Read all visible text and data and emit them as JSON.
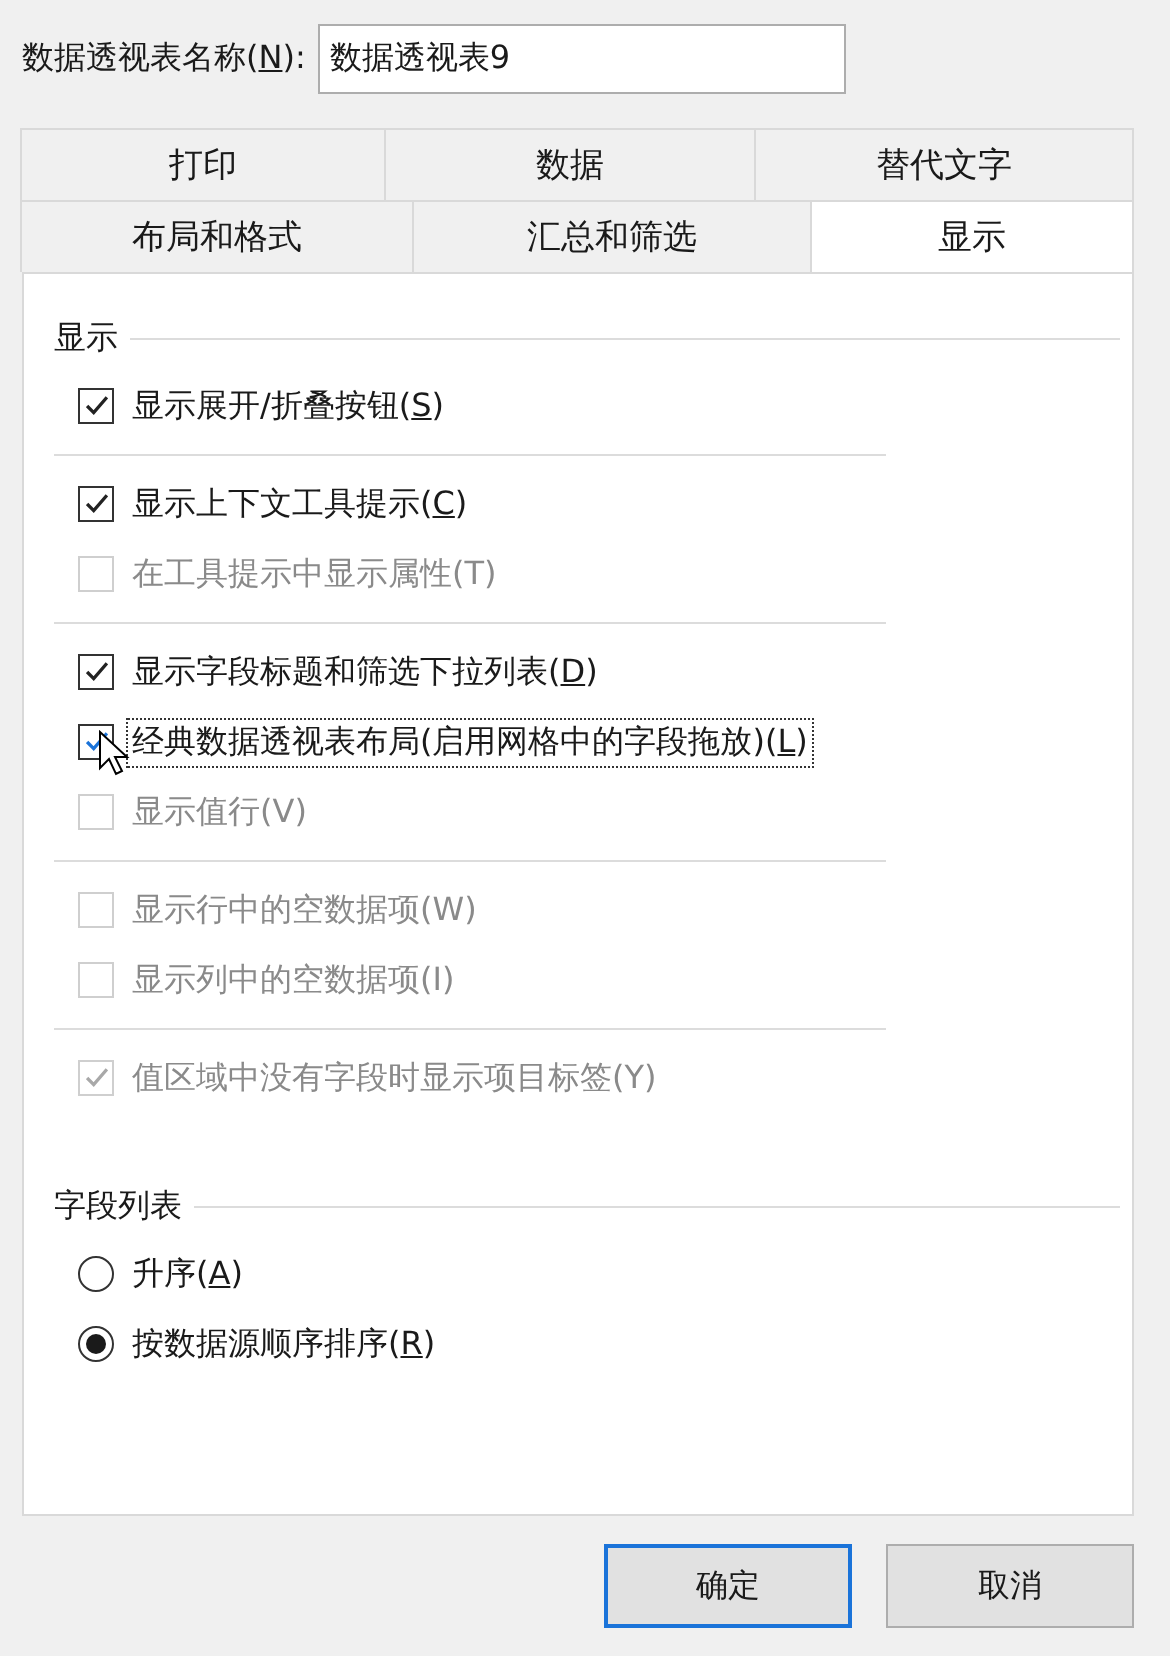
{
  "name_field": {
    "label": "数据透视表名称(",
    "hotkey": "N",
    "label_end": "):",
    "value": "数据透视表9"
  },
  "tab_rows": [
    [
      {
        "label": "打印",
        "selected": false
      },
      {
        "label": "数据",
        "selected": false
      },
      {
        "label": "替代文字",
        "selected": false
      }
    ],
    [
      {
        "label": "布局和格式",
        "selected": false
      },
      {
        "label": "汇总和筛选",
        "selected": false
      },
      {
        "label": "显示",
        "selected": true
      }
    ]
  ],
  "display_section": {
    "title": "显示",
    "groups": [
      [
        {
          "label": "显示展开/折叠按钮(",
          "hotkey": "S",
          "label_end": ")",
          "checked": true,
          "disabled": false,
          "focused": false
        }
      ],
      [
        {
          "label": "显示上下文工具提示(",
          "hotkey": "C",
          "label_end": ")",
          "checked": true,
          "disabled": false,
          "focused": false
        },
        {
          "label": "在工具提示中显示属性(T)",
          "checked": false,
          "disabled": true,
          "focused": false
        }
      ],
      [
        {
          "label": "显示字段标题和筛选下拉列表(",
          "hotkey": "D",
          "label_end": ")",
          "checked": true,
          "disabled": false,
          "focused": false
        },
        {
          "label": "经典数据透视表布局(启用网格中的字段拖放)(",
          "hotkey": "L",
          "label_end": ")",
          "checked": true,
          "disabled": false,
          "focused": true
        },
        {
          "label": "显示值行(V)",
          "checked": false,
          "disabled": true,
          "focused": false
        }
      ],
      [
        {
          "label": "显示行中的空数据项(W)",
          "checked": false,
          "disabled": true,
          "focused": false
        },
        {
          "label": "显示列中的空数据项(I)",
          "checked": false,
          "disabled": true,
          "focused": false
        }
      ],
      [
        {
          "label": "值区域中没有字段时显示项目标签(Y)",
          "checked": true,
          "disabled": true,
          "focused": false
        }
      ]
    ]
  },
  "field_list_section": {
    "title": "字段列表",
    "options": [
      {
        "label": "升序(",
        "hotkey": "A",
        "label_end": ")",
        "selected": false
      },
      {
        "label": "按数据源顺序排序(",
        "hotkey": "R",
        "label_end": ")",
        "selected": true
      }
    ]
  },
  "buttons": [
    {
      "label": "确定",
      "default": true
    },
    {
      "label": "取消",
      "default": false
    }
  ]
}
